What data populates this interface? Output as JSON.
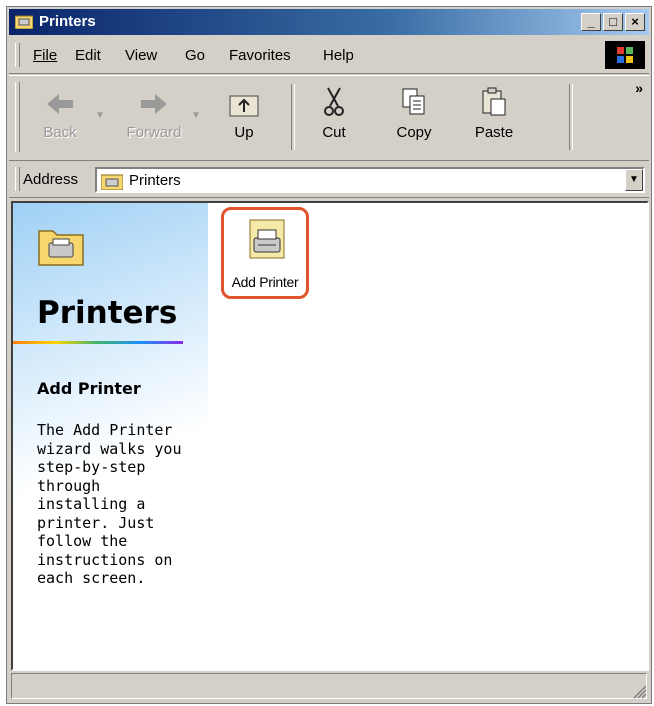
{
  "window": {
    "title": "Printers"
  },
  "menubar": {
    "items": [
      "File",
      "Edit",
      "View",
      "Go",
      "Favorites",
      "Help"
    ]
  },
  "toolbar": {
    "back_label": "Back",
    "forward_label": "Forward",
    "up_label": "Up",
    "cut_label": "Cut",
    "copy_label": "Copy",
    "paste_label": "Paste",
    "more": "»"
  },
  "address": {
    "label": "Address",
    "value": "Printers"
  },
  "leftpane": {
    "title": "Printers",
    "heading": "Add Printer",
    "description": "The Add Printer wizard walks you step-by-step through installing a printer. Just follow the instructions on each screen."
  },
  "items": [
    {
      "label": "Add Printer",
      "icon": "add-printer-icon"
    }
  ],
  "colors": {
    "highlight": "#e2542b",
    "titlebar": "#0a246a"
  }
}
